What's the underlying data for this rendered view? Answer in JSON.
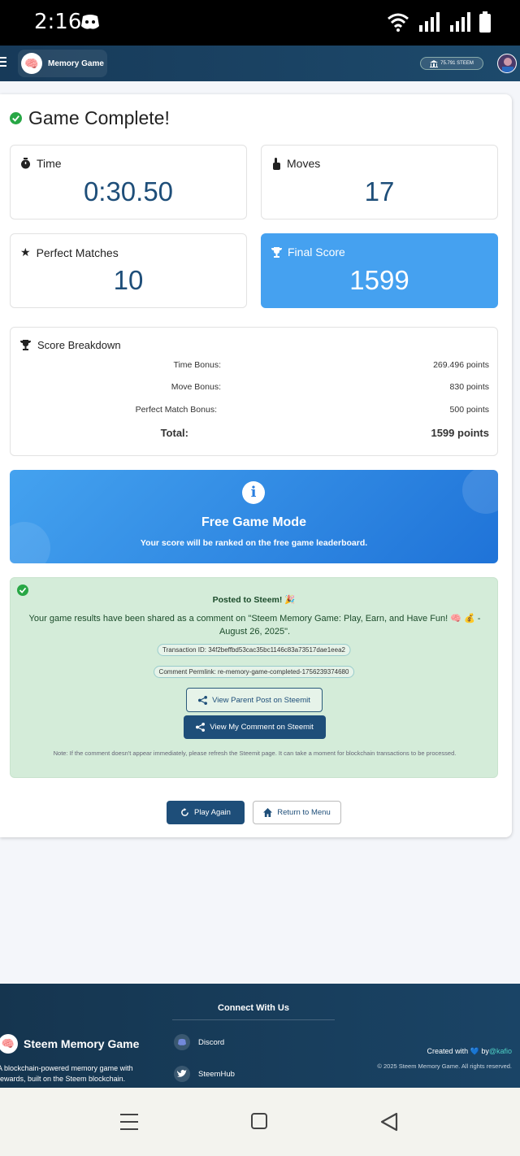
{
  "status_bar": {
    "time": "2:16"
  },
  "navbar": {
    "app_title": "Memory Game",
    "balance": "75.791 STEEM"
  },
  "main": {
    "title": "Game Complete!",
    "stats": {
      "time_label": "Time",
      "time_value": "0:30.50",
      "moves_label": "Moves",
      "moves_value": "17",
      "perfect_label": "Perfect Matches",
      "perfect_value": "10",
      "score_label": "Final Score",
      "score_value": "1599"
    },
    "breakdown": {
      "title": "Score Breakdown",
      "rows": [
        {
          "label": "Time Bonus:",
          "value": "269.496 points"
        },
        {
          "label": "Move Bonus:",
          "value": "830 points"
        },
        {
          "label": "Perfect Match Bonus:",
          "value": "500 points"
        }
      ],
      "total_label": "Total:",
      "total_value": "1599 points"
    },
    "free_mode": {
      "title": "Free Game Mode",
      "subtitle": "Your score will be ranked on the free game leaderboard."
    },
    "posted": {
      "title": "Posted to Steem! 🎉",
      "text": "Your game results have been shared as a comment on \"Steem Memory Game: Play, Earn, and Have Fun! 🧠 💰 - August 26, 2025\".",
      "transaction": "Transaction ID: 34f2beffbd53cac35bc1146c83a73517dae1eea2",
      "permlink": "Comment Permlink: re-memory-game-completed-1756239374680",
      "view_parent": "View Parent Post on Steemit",
      "view_comment": "View My Comment on Steemit",
      "note": "Note: If the comment doesn't appear immediately, please refresh the Steemit page. It can take a moment for blockchain transactions to be processed."
    },
    "actions": {
      "play_again": "Play Again",
      "return_menu": "Return to Menu"
    }
  },
  "footer": {
    "connect": "Connect With Us",
    "discord": "Discord",
    "steemhub": "SteemHub",
    "brand": "Steem Memory Game",
    "description": "A blockchain-powered memory game with rewards, built on the Steem blockchain.",
    "created_prefix": "Created with",
    "created_by": "by",
    "author": "@kafio",
    "copyright": "© 2025 Steem Memory Game. All rights reserved."
  },
  "colors": {
    "navy": "#1e4e79",
    "blue": "#45a1f0",
    "green_bg": "#d4ecd9",
    "teal_link": "#4fd1c5"
  }
}
